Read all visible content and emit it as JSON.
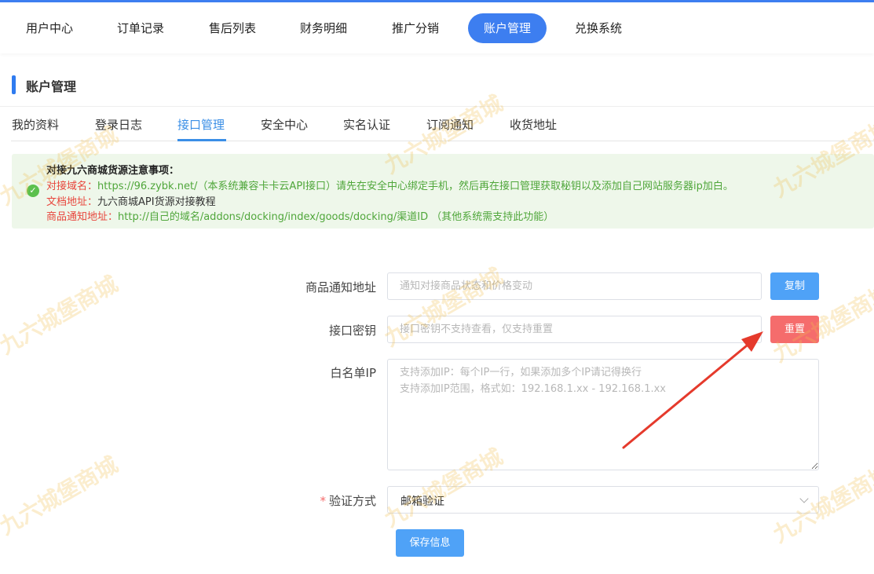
{
  "top_nav": [
    {
      "label": "用户中心",
      "active": false
    },
    {
      "label": "订单记录",
      "active": false
    },
    {
      "label": "售后列表",
      "active": false
    },
    {
      "label": "财务明细",
      "active": false
    },
    {
      "label": "推广分销",
      "active": false
    },
    {
      "label": "账户管理",
      "active": true
    },
    {
      "label": "兑换系统",
      "active": false
    }
  ],
  "section_title": "账户管理",
  "tabs": [
    {
      "label": "我的资料",
      "active": false
    },
    {
      "label": "登录日志",
      "active": false
    },
    {
      "label": "接口管理",
      "active": true
    },
    {
      "label": "安全中心",
      "active": false
    },
    {
      "label": "实名认证",
      "active": false
    },
    {
      "label": "订阅通知",
      "active": false
    },
    {
      "label": "收货地址",
      "active": false
    }
  ],
  "notice": {
    "title": "对接九六商城货源注意事项：",
    "domain_label": "对接域名：",
    "domain_value": "https://96.zybk.net/（本系统兼容卡卡云API接口）请先在安全中心绑定手机，然后再在接口管理获取秘钥以及添加自己网站服务器ip加白。",
    "doc_label": "文档地址：",
    "doc_value": "九六商城API货源对接教程",
    "notify_label": "商品通知地址：",
    "notify_value": "http://自己的域名/addons/docking/index/goods/docking/渠道ID （其他系统需支持此功能）"
  },
  "form": {
    "notify_url": {
      "label": "商品通知地址",
      "value": "",
      "placeholder": "通知对接商品状态和价格变动",
      "button": "复制"
    },
    "api_key": {
      "label": "接口密钥",
      "value": "",
      "placeholder": "接口密钥不支持查看，仅支持重置",
      "button": "重置"
    },
    "whitelist": {
      "label": "白名单IP",
      "value": "",
      "placeholder": "支持添加IP：每个IP一行，如果添加多个IP请记得换行\n支持添加IP范围，格式如：192.168.1.xx - 192.168.1.xx"
    },
    "verify": {
      "required_mark": "*",
      "label": "验证方式",
      "selected": "邮箱验证"
    },
    "save_button": "保存信息"
  },
  "watermark_text": "九六城堡商城",
  "colors": {
    "primary": "#3d7ef0",
    "button_blue": "#4fa2f7",
    "button_red": "#f56c6c",
    "notice_bg": "#eef7ea",
    "arrow": "#e53a2c"
  }
}
